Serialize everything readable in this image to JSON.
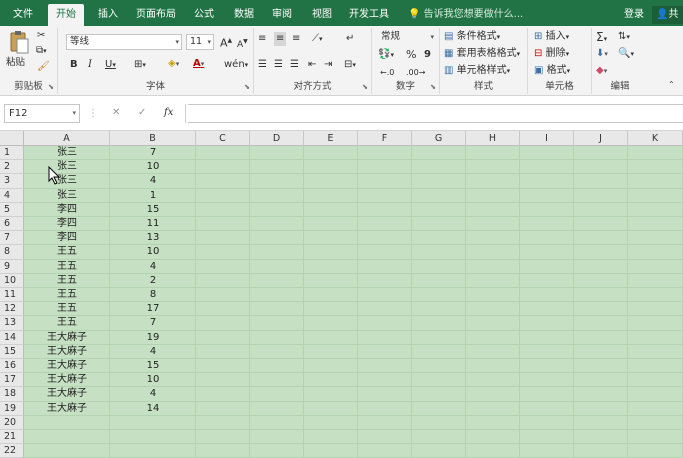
{
  "tabs": [
    "文件",
    "开始",
    "插入",
    "页面布局",
    "公式",
    "数据",
    "审阅",
    "视图",
    "开发工具"
  ],
  "tell_me": "告诉我您想要做什么...",
  "login": "登录",
  "share": "共",
  "clipboard": {
    "paste": "粘贴",
    "label": "剪贴板"
  },
  "font": {
    "name": "等线",
    "size": "11",
    "label": "字体",
    "bold": "B",
    "italic": "I",
    "underline": "U",
    "grow": "A",
    "shrink": "A",
    "color_letter": "A"
  },
  "alignment": {
    "label": "对齐方式"
  },
  "number": {
    "format": "常规",
    "label": "数字",
    "percent": "%",
    "comma": "9"
  },
  "styles": {
    "conditional": "条件格式",
    "table": "套用表格格式",
    "cell": "单元格样式",
    "label": "样式"
  },
  "cells": {
    "insert": "插入",
    "delete": "删除",
    "format": "格式",
    "label": "单元格"
  },
  "editing": {
    "label": "编辑"
  },
  "name_box": "F12",
  "formula": {
    "cancel": "✕",
    "enter": "✓",
    "fx": "fx"
  },
  "columns": [
    "A",
    "B",
    "C",
    "D",
    "E",
    "F",
    "G",
    "H",
    "I",
    "J",
    "K"
  ],
  "rows": [
    "1",
    "2",
    "3",
    "4",
    "5",
    "6",
    "7",
    "8",
    "9",
    "10",
    "11",
    "12",
    "13",
    "14",
    "15",
    "16",
    "17",
    "18",
    "19",
    "20",
    "21",
    "22"
  ],
  "data": [
    {
      "a": "张三",
      "b": "7"
    },
    {
      "a": "张三",
      "b": "10"
    },
    {
      "a": "张三",
      "b": "4"
    },
    {
      "a": "张三",
      "b": "1"
    },
    {
      "a": "李四",
      "b": "15"
    },
    {
      "a": "李四",
      "b": "11"
    },
    {
      "a": "李四",
      "b": "13"
    },
    {
      "a": "王五",
      "b": "10"
    },
    {
      "a": "王五",
      "b": "4"
    },
    {
      "a": "王五",
      "b": "2"
    },
    {
      "a": "王五",
      "b": "8"
    },
    {
      "a": "王五",
      "b": "17"
    },
    {
      "a": "王五",
      "b": "7"
    },
    {
      "a": "王大麻子",
      "b": "19"
    },
    {
      "a": "王大麻子",
      "b": "4"
    },
    {
      "a": "王大麻子",
      "b": "15"
    },
    {
      "a": "王大麻子",
      "b": "10"
    },
    {
      "a": "王大麻子",
      "b": "4"
    },
    {
      "a": "王大麻子",
      "b": "14"
    }
  ]
}
